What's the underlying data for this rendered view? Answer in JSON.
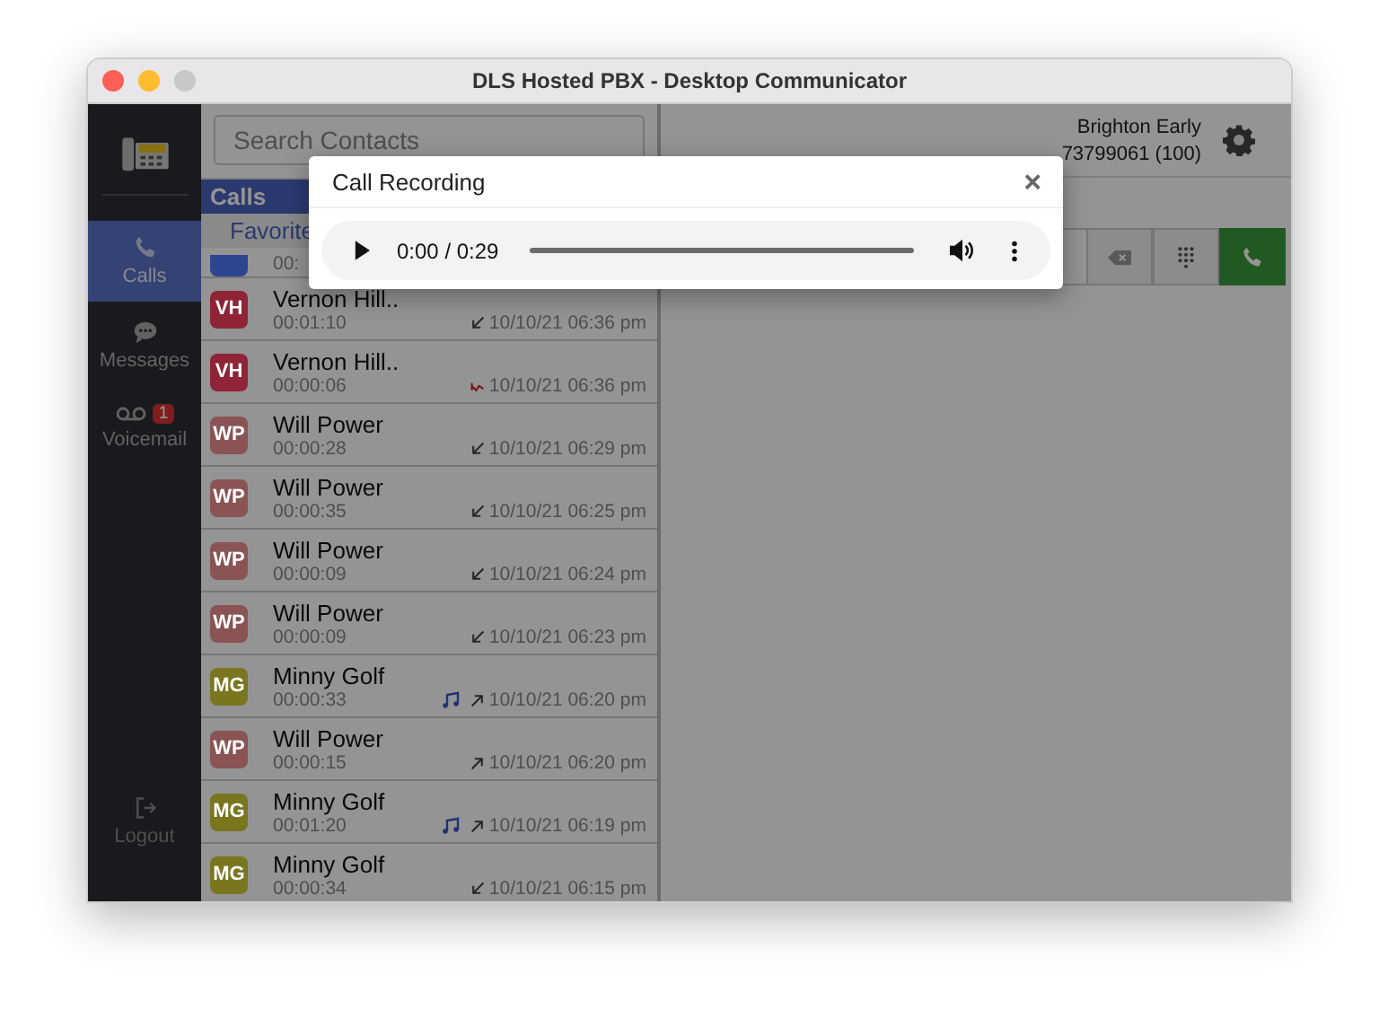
{
  "window": {
    "title": "DLS Hosted PBX - Desktop Communicator"
  },
  "sidebar": {
    "items": [
      {
        "label": "Calls",
        "kind": "phone",
        "selected": true
      },
      {
        "label": "Messages",
        "kind": "chat",
        "selected": false
      },
      {
        "label": "Voicemail",
        "kind": "voicemail",
        "selected": false,
        "badge": "1"
      }
    ],
    "logout": "Logout"
  },
  "search": {
    "placeholder": "Search Contacts"
  },
  "calls_header": "Calls",
  "tabs": [
    {
      "label": "Favorite",
      "selected": false
    }
  ],
  "first_row": {
    "duration": "00:",
    "color": "#2e4590"
  },
  "calls": [
    {
      "initials": "VH",
      "name": "Vernon Hill..",
      "duration": "00:01:10",
      "time": "10/10/21 06:36 pm",
      "kind": "incoming",
      "recording": false,
      "color": "#8e2436"
    },
    {
      "initials": "VH",
      "name": "Vernon Hill..",
      "duration": "00:00:06",
      "time": "10/10/21 06:36 pm",
      "kind": "missed",
      "recording": false,
      "color": "#8e2436"
    },
    {
      "initials": "WP",
      "name": "Will Power",
      "duration": "00:00:28",
      "time": "10/10/21 06:29 pm",
      "kind": "incoming",
      "recording": false,
      "color": "#8a5454"
    },
    {
      "initials": "WP",
      "name": "Will Power",
      "duration": "00:00:35",
      "time": "10/10/21 06:25 pm",
      "kind": "incoming",
      "recording": false,
      "color": "#8a5454"
    },
    {
      "initials": "WP",
      "name": "Will Power",
      "duration": "00:00:09",
      "time": "10/10/21 06:24 pm",
      "kind": "incoming",
      "recording": false,
      "color": "#8a5454"
    },
    {
      "initials": "WP",
      "name": "Will Power",
      "duration": "00:00:09",
      "time": "10/10/21 06:23 pm",
      "kind": "incoming",
      "recording": false,
      "color": "#8a5454"
    },
    {
      "initials": "MG",
      "name": "Minny Golf",
      "duration": "00:00:33",
      "time": "10/10/21 06:20 pm",
      "kind": "outgoing",
      "recording": true,
      "color": "#7a7620"
    },
    {
      "initials": "WP",
      "name": "Will Power",
      "duration": "00:00:15",
      "time": "10/10/21 06:20 pm",
      "kind": "outgoing",
      "recording": false,
      "color": "#8a5454"
    },
    {
      "initials": "MG",
      "name": "Minny Golf",
      "duration": "00:01:20",
      "time": "10/10/21 06:19 pm",
      "kind": "outgoing",
      "recording": true,
      "color": "#7a7620"
    },
    {
      "initials": "MG",
      "name": "Minny Golf",
      "duration": "00:00:34",
      "time": "10/10/21 06:15 pm",
      "kind": "incoming",
      "recording": false,
      "color": "#7a7620"
    }
  ],
  "user": {
    "name": "Brighton Early",
    "number": "73799061 (100)"
  },
  "modal": {
    "title": "Call Recording",
    "close": "×",
    "player": {
      "time": "0:00 / 0:29",
      "level": 0
    }
  }
}
